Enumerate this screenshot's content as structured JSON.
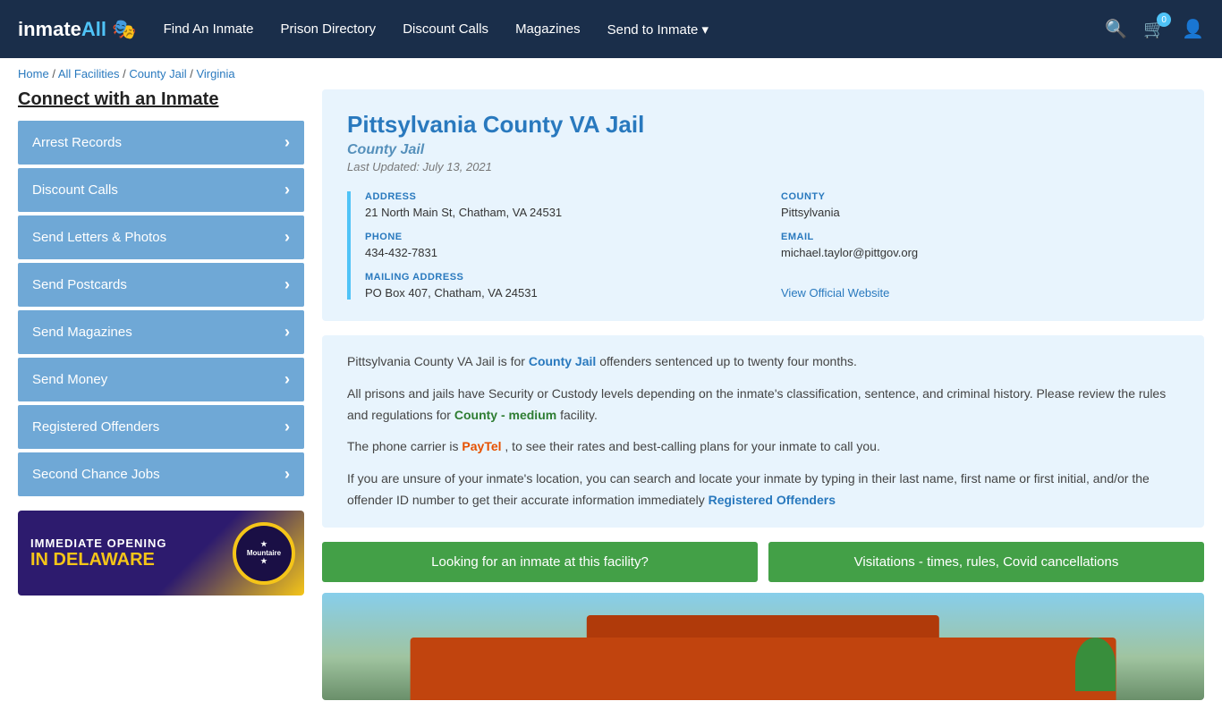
{
  "header": {
    "logo_text": "inmate",
    "logo_all": "All",
    "logo_emoji": "🎭",
    "nav": [
      {
        "id": "find-inmate",
        "label": "Find An Inmate"
      },
      {
        "id": "prison-directory",
        "label": "Prison Directory"
      },
      {
        "id": "discount-calls",
        "label": "Discount Calls"
      },
      {
        "id": "magazines",
        "label": "Magazines"
      },
      {
        "id": "send-to-inmate",
        "label": "Send to Inmate ▾"
      }
    ],
    "cart_count": "0"
  },
  "breadcrumb": {
    "home": "Home",
    "separator1": " / ",
    "all_facilities": "All Facilities",
    "separator2": " / ",
    "county_jail": "County Jail",
    "separator3": " / ",
    "state": "Virginia"
  },
  "sidebar": {
    "title": "Connect with an Inmate",
    "items": [
      {
        "id": "arrest-records",
        "label": "Arrest Records"
      },
      {
        "id": "discount-calls",
        "label": "Discount Calls"
      },
      {
        "id": "send-letters",
        "label": "Send Letters & Photos"
      },
      {
        "id": "send-postcards",
        "label": "Send Postcards"
      },
      {
        "id": "send-magazines",
        "label": "Send Magazines"
      },
      {
        "id": "send-money",
        "label": "Send Money"
      },
      {
        "id": "registered-offenders",
        "label": "Registered Offenders"
      },
      {
        "id": "second-chance-jobs",
        "label": "Second Chance Jobs"
      }
    ],
    "ad": {
      "immediate": "IMMEDIATE OPENING",
      "in_delaware": "IN DELAWARE",
      "brand": "Mountaire"
    }
  },
  "facility": {
    "name": "Pittsylvania County VA Jail",
    "type": "County Jail",
    "last_updated": "Last Updated: July 13, 2021",
    "address_label": "ADDRESS",
    "address": "21 North Main St, Chatham, VA 24531",
    "county_label": "COUNTY",
    "county": "Pittsylvania",
    "phone_label": "PHONE",
    "phone": "434-432-7831",
    "email_label": "EMAIL",
    "email": "michael.taylor@pittgov.org",
    "mailing_label": "MAILING ADDRESS",
    "mailing": "PO Box 407, Chatham, VA 24531",
    "website_label": "View Official Website",
    "desc1": "Pittsylvania County VA Jail is for ",
    "desc1_link": "County Jail",
    "desc1_end": " offenders sentenced up to twenty four months.",
    "desc2": "All prisons and jails have Security or Custody levels depending on the inmate's classification, sentence, and criminal history. Please review the rules and regulations for ",
    "desc2_link": "County - medium",
    "desc2_end": " facility.",
    "desc3": "The phone carrier is ",
    "desc3_link": "PayTel",
    "desc3_end": ", to see their rates and best-calling plans for your inmate to call you.",
    "desc4": "If you are unsure of your inmate's location, you can search and locate your inmate by typing in their last name, first name or first initial, and/or the offender ID number to get their accurate information immediately ",
    "desc4_link": "Registered Offenders",
    "btn1": "Looking for an inmate at this facility?",
    "btn2": "Visitations - times, rules, Covid cancellations"
  }
}
